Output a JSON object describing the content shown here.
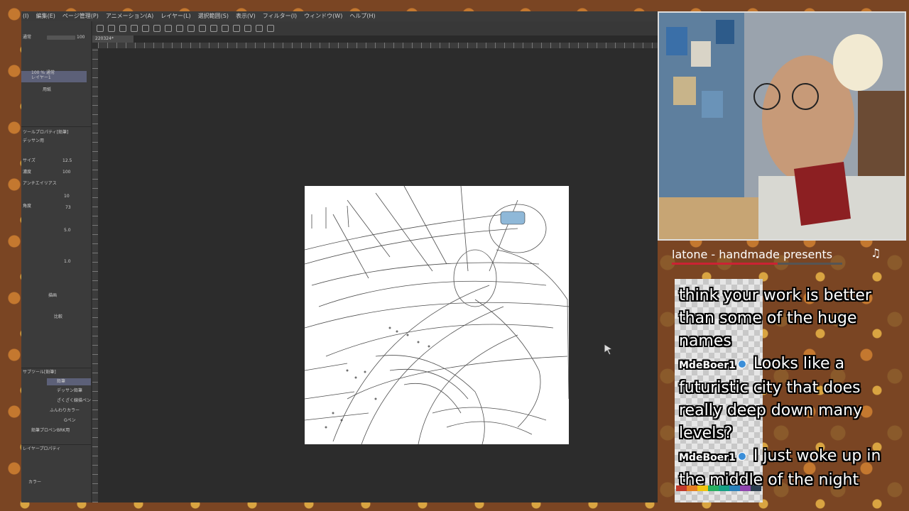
{
  "app": {
    "menu": [
      "(I)",
      "編集(E)",
      "ページ管理(P)",
      "アニメーション(A)",
      "レイヤー(L)",
      "選択範囲(S)",
      "表示(V)",
      "フィルター(I)",
      "ウィンドウ(W)",
      "ヘルプ(H)"
    ],
    "doc_tab": "220324*",
    "left_panel": {
      "mode_label": "通常",
      "opacity_value": "100",
      "layer_name": "100 % 通常",
      "layer_sub": "レイヤー1",
      "paper_layer": "用紙",
      "tool_property_title": "ツールプロパティ[鉛筆]",
      "brush_name": "デッサン用",
      "size_label": "サイズ",
      "size_value": "12.5",
      "density_label": "濃度",
      "density_value": "100",
      "antialias_label": "アンチエイリアス",
      "value_10": "10",
      "angle_label": "角度",
      "value_73": "73",
      "value_50": "5.0",
      "value_10b": "1.0",
      "main_button": "描画",
      "compare_label": "比較",
      "sub_tool_title": "サブツール[鉛筆]",
      "brush_tab": "鉛筆",
      "sub_tools": [
        "デッサン鉛筆",
        "ざくざく線描ペン",
        "ふんわりカラー",
        "Gペン",
        "鉛筆プロペンBRK用"
      ],
      "layer_property_title": "レイヤープロパティ",
      "color_label": "カラー"
    }
  },
  "stream": {
    "music_title": "latone - handmade presents",
    "music_note": "♫",
    "music_progress": 0.62,
    "chat": [
      {
        "user": "",
        "text": "think your work is better than some of the huge names"
      },
      {
        "user": "MdeBoer1",
        "text": "Looks like a futuristic city that does really deep down many levels?"
      },
      {
        "user": "MdeBoer1",
        "text": "I just woke up in the middle of the night"
      }
    ],
    "palette_colors": [
      "#c0392b",
      "#e67e22",
      "#f1c40f",
      "#27ae60",
      "#16a085",
      "#2980b9",
      "#8e44ad",
      "#2c3e50"
    ]
  }
}
